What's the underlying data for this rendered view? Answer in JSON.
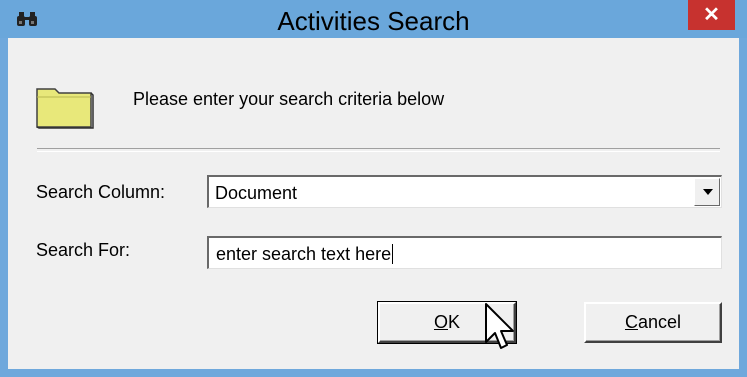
{
  "window": {
    "title": "Activities Search",
    "close_glyph": "✕"
  },
  "header": {
    "instruction": "Please enter your search criteria below",
    "icon": "folder-icon"
  },
  "form": {
    "search_column": {
      "label": "Search Column:",
      "value": "Document"
    },
    "search_for": {
      "label": "Search For:",
      "value": "enter search text here"
    }
  },
  "buttons": {
    "ok": {
      "mnemonic": "O",
      "rest": "K"
    },
    "cancel": {
      "mnemonic": "C",
      "rest": "ancel"
    }
  },
  "colors": {
    "title_bar": "#6aa7db",
    "close_button": "#c7322f",
    "client_background": "#f0f0f0",
    "folder_fill": "#e8e87a"
  }
}
